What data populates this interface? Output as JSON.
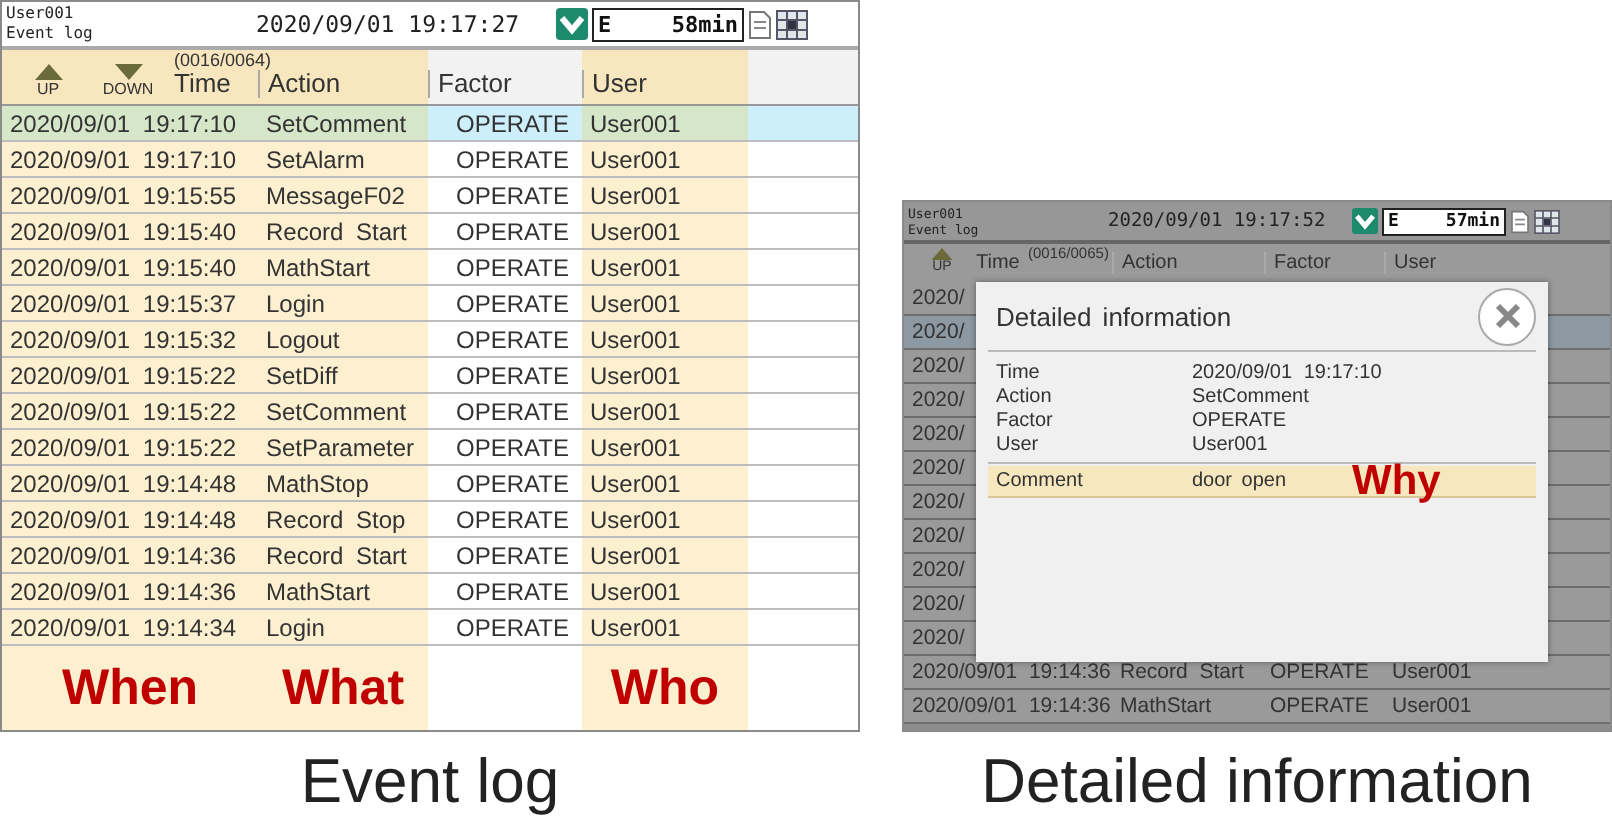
{
  "event_log": {
    "header": {
      "user": "User001",
      "screen": "Event log",
      "datetime": "2020/09/01 19:17:27",
      "status": "E",
      "remaining": "58min"
    },
    "nav": {
      "up": "UP",
      "down": "DOWN"
    },
    "counter": "(0016/0064)",
    "columns": [
      "Time",
      "Action",
      "Factor",
      "User"
    ],
    "rows": [
      {
        "time": "2020/09/01 19:17:10",
        "action": "SetComment",
        "factor": "OPERATE",
        "user": "User001",
        "selected": true
      },
      {
        "time": "2020/09/01 19:17:10",
        "action": "SetAlarm",
        "factor": "OPERATE",
        "user": "User001",
        "selected": false
      },
      {
        "time": "2020/09/01 19:15:55",
        "action": "MessageF02",
        "factor": "OPERATE",
        "user": "User001",
        "selected": false
      },
      {
        "time": "2020/09/01 19:15:40",
        "action": "Record Start",
        "factor": "OPERATE",
        "user": "User001",
        "selected": false
      },
      {
        "time": "2020/09/01 19:15:40",
        "action": "MathStart",
        "factor": "OPERATE",
        "user": "User001",
        "selected": false
      },
      {
        "time": "2020/09/01 19:15:37",
        "action": "Login",
        "factor": "OPERATE",
        "user": "User001",
        "selected": false
      },
      {
        "time": "2020/09/01 19:15:32",
        "action": "Logout",
        "factor": "OPERATE",
        "user": "User001",
        "selected": false
      },
      {
        "time": "2020/09/01 19:15:22",
        "action": "SetDiff",
        "factor": "OPERATE",
        "user": "User001",
        "selected": false
      },
      {
        "time": "2020/09/01 19:15:22",
        "action": "SetComment",
        "factor": "OPERATE",
        "user": "User001",
        "selected": false
      },
      {
        "time": "2020/09/01 19:15:22",
        "action": "SetParameter",
        "factor": "OPERATE",
        "user": "User001",
        "selected": false
      },
      {
        "time": "2020/09/01 19:14:48",
        "action": "MathStop",
        "factor": "OPERATE",
        "user": "User001",
        "selected": false
      },
      {
        "time": "2020/09/01 19:14:48",
        "action": "Record Stop",
        "factor": "OPERATE",
        "user": "User001",
        "selected": false
      },
      {
        "time": "2020/09/01 19:14:36",
        "action": "Record Start",
        "factor": "OPERATE",
        "user": "User001",
        "selected": false
      },
      {
        "time": "2020/09/01 19:14:36",
        "action": "MathStart",
        "factor": "OPERATE",
        "user": "User001",
        "selected": false
      },
      {
        "time": "2020/09/01 19:14:34",
        "action": "Login",
        "factor": "OPERATE",
        "user": "User001",
        "selected": false
      }
    ],
    "annotations": {
      "time": "When",
      "action": "What",
      "user": "Who"
    },
    "caption": "Event log"
  },
  "detail_view": {
    "header": {
      "user": "User001",
      "screen": "Event log",
      "datetime": "2020/09/01 19:17:52",
      "status": "E",
      "remaining": "57min"
    },
    "nav": {
      "up": "UP"
    },
    "counter": "(0016/0065)",
    "columns": [
      "Time",
      "Action",
      "Factor",
      "User"
    ],
    "rows": [
      {
        "kind": "covered",
        "time": "2020/",
        "selected": false
      },
      {
        "kind": "covered",
        "time": "2020/",
        "selected": true
      },
      {
        "kind": "covered",
        "time": "2020/",
        "selected": false
      },
      {
        "kind": "covered",
        "time": "2020/",
        "selected": false
      },
      {
        "kind": "covered",
        "time": "2020/",
        "selected": false
      },
      {
        "kind": "covered",
        "time": "2020/",
        "selected": false
      },
      {
        "kind": "covered",
        "time": "2020/",
        "selected": false
      },
      {
        "kind": "covered",
        "time": "2020/",
        "selected": false
      },
      {
        "kind": "covered",
        "time": "2020/",
        "selected": false
      },
      {
        "kind": "covered",
        "time": "2020/",
        "selected": false
      },
      {
        "kind": "covered",
        "time": "2020/",
        "selected": false
      },
      {
        "kind": "full",
        "time": "2020/09/01 19:14:36",
        "action": "Record Start",
        "factor": "OPERATE",
        "user": "User001",
        "selected": false
      },
      {
        "kind": "full",
        "time": "2020/09/01 19:14:36",
        "action": "MathStart",
        "factor": "OPERATE",
        "user": "User001",
        "selected": false
      }
    ],
    "dialog": {
      "title": "Detailed information",
      "fields": [
        {
          "label": "Time",
          "value": "2020/09/01 19:17:10"
        },
        {
          "label": "Action",
          "value": "SetComment"
        },
        {
          "label": "Factor",
          "value": "OPERATE"
        },
        {
          "label": "User",
          "value": "User001"
        }
      ],
      "comment": {
        "label": "Comment",
        "value": "door open"
      },
      "annotation": "Why"
    },
    "caption": "Detailed information"
  }
}
